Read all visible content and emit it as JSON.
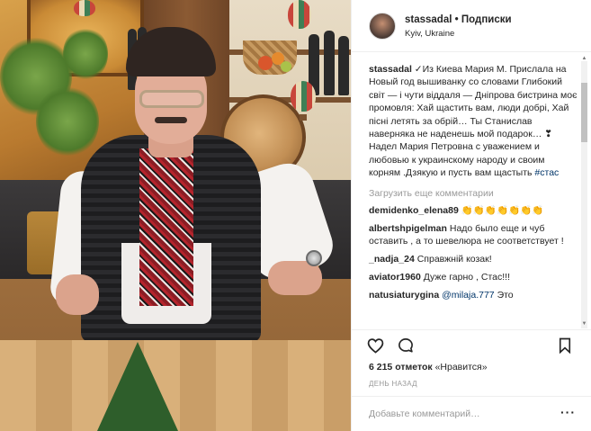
{
  "header": {
    "username": "stassadal",
    "separator": "•",
    "follow_label": "Подписки",
    "location": "Kyiv, Ukraine"
  },
  "caption": {
    "username": "stassadal",
    "text": "✓Из Киева Мария М. Прислала на Новый год вышиванку со словами Глибокий світ — і чути віддаля — Дніпрова бистрина моє промовля: Хай щастить вам, люди добрі, Хай пісні летять за обрій… Ты Станислав наверняка не наденешь мой подарок… ❣ Надел Мария Петровна с уважением и любовью к украинскому народу и своим корням .Дзякую и пусть вам щастыть",
    "hashtag": "#стас"
  },
  "load_more_label": "Загрузить еще комментарии",
  "comments": [
    {
      "username": "demidenko_elena89",
      "text": "👏👏👏👏👏👏👏"
    },
    {
      "username": "albertshpigelman",
      "text": "Надо было еще и чуб оставить , а то шевелюра не соответствует !"
    },
    {
      "username": "_nadja_24",
      "text": "Справжній козак!"
    },
    {
      "username": "aviator1960",
      "text": "Дуже гарно , Стас!!!"
    },
    {
      "username": "natusiaturygina",
      "mention": "@milaja.777",
      "text": "Это"
    }
  ],
  "actions": {
    "like_icon": "heart-icon",
    "comment_icon": "comment-icon",
    "save_icon": "bookmark-icon"
  },
  "likes": {
    "count": "6 215 отметок",
    "label": "«Нравится»"
  },
  "time_ago": "ДЕНЬ НАЗАД",
  "add_comment": {
    "placeholder": "Добавьте комментарий…",
    "more_label": "···"
  },
  "colors": {
    "text": "#262626",
    "muted": "#999999",
    "link": "#003569",
    "border": "#efefef"
  }
}
